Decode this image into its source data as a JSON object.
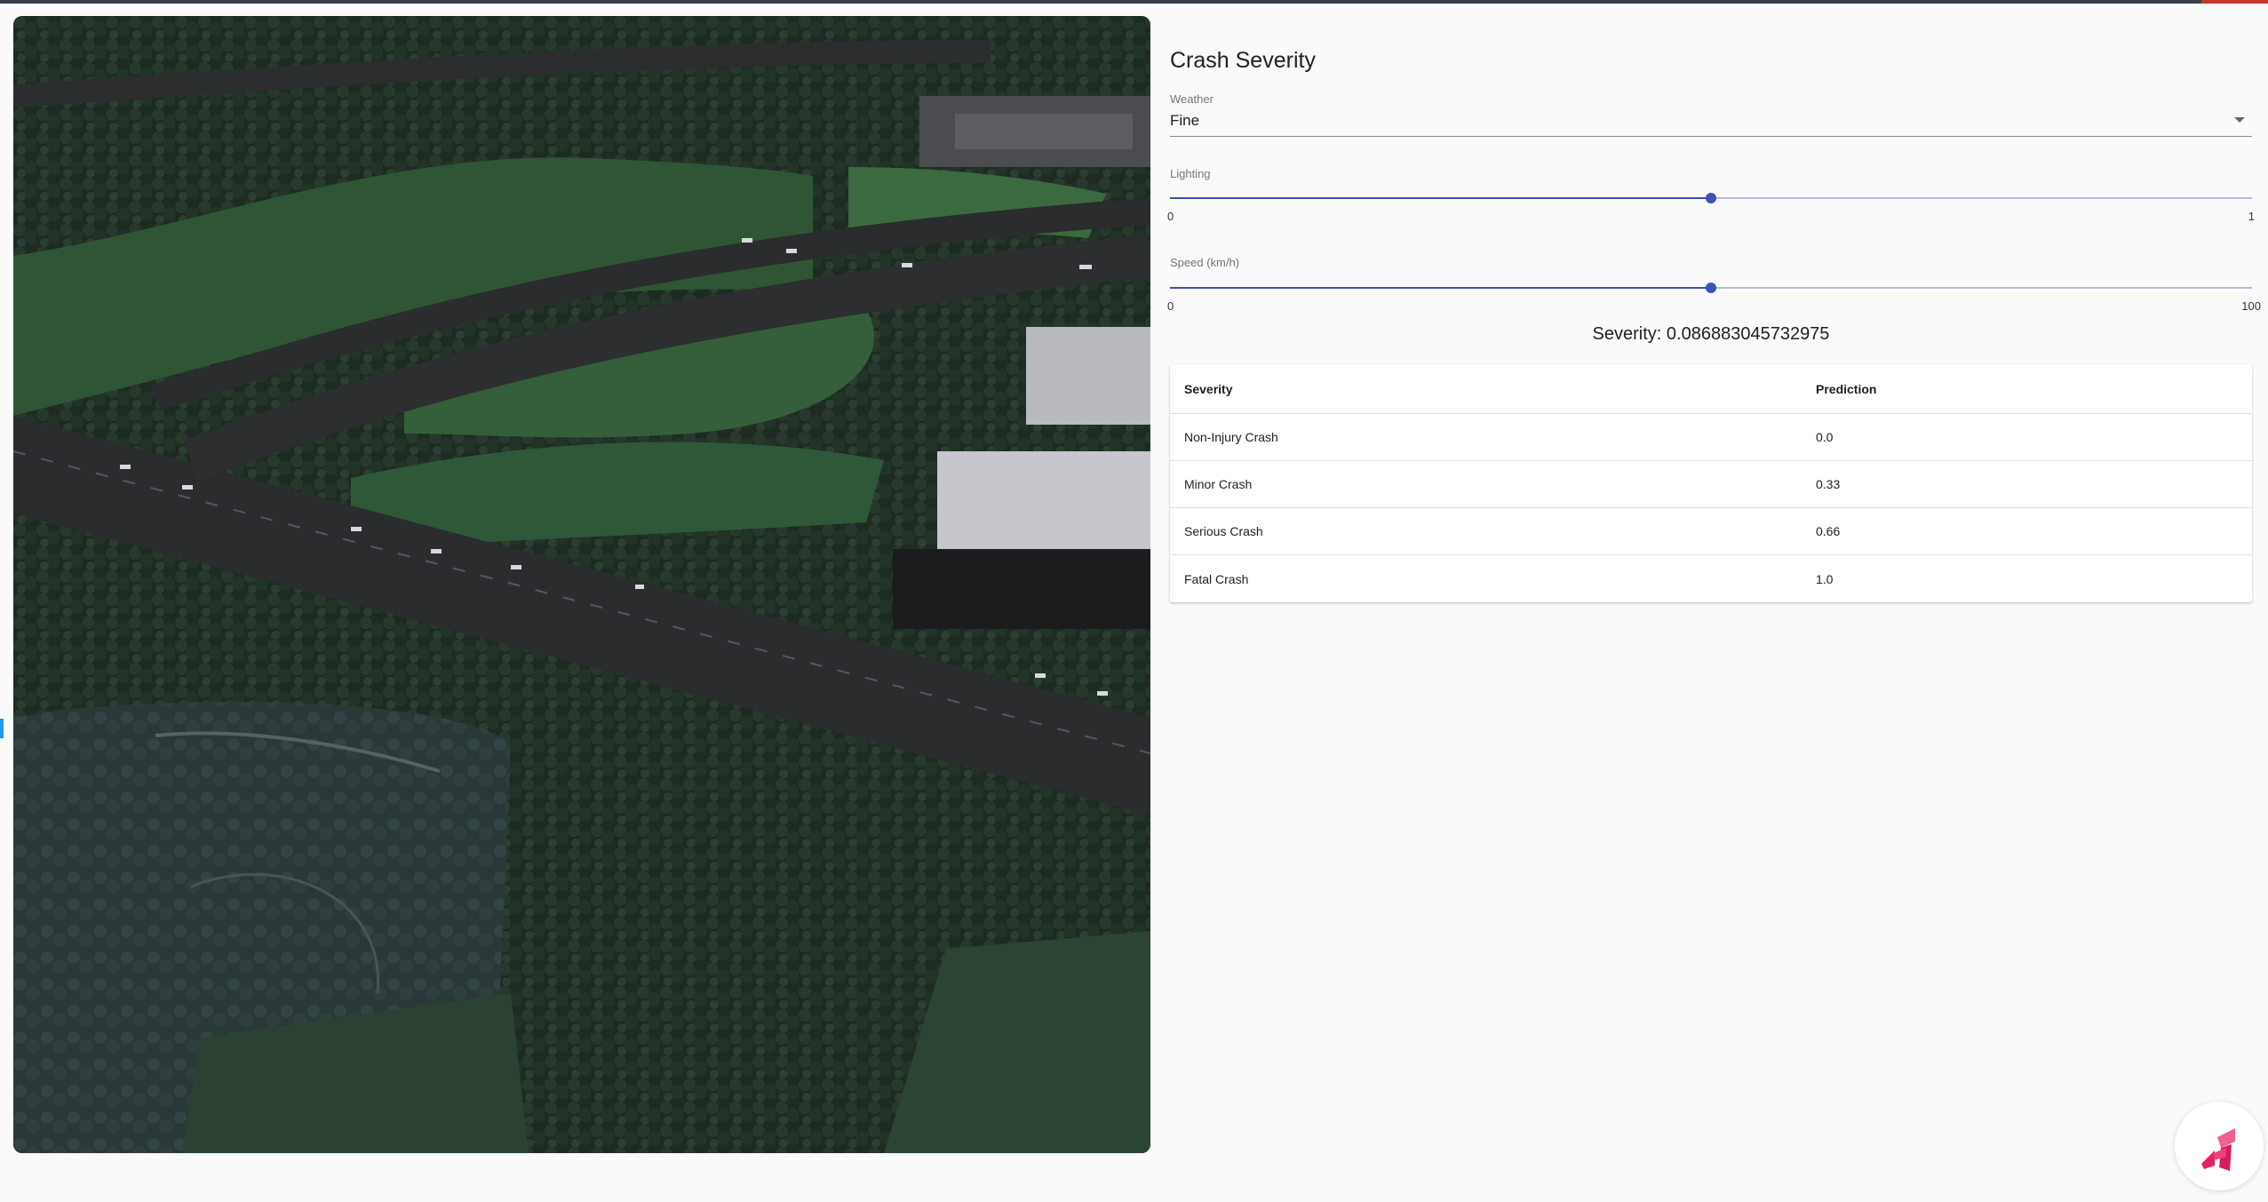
{
  "app": {
    "title": "Crash Severity",
    "accent_color": "#3f51b5"
  },
  "aerial_view": {
    "icon": "aerial-map-image"
  },
  "weather": {
    "label": "Weather",
    "value": "Fine",
    "icon": "chevron-down-icon"
  },
  "lighting": {
    "label": "Lighting",
    "min_label": "0",
    "max_label": "1",
    "value_fraction": 0.5
  },
  "speed": {
    "label": "Speed (km/h)",
    "min_label": "0",
    "max_label": "100",
    "value_fraction": 0.5
  },
  "result": {
    "severity_text": "Severity: 0.086883045732975"
  },
  "table": {
    "headers": [
      "Severity",
      "Prediction"
    ],
    "rows": [
      [
        "Non-Injury Crash",
        "0.0"
      ],
      [
        "Minor Crash",
        "0.33"
      ],
      [
        "Serious Crash",
        "0.66"
      ],
      [
        "Fatal Crash",
        "1.0"
      ]
    ]
  },
  "fab": {
    "icon": "app-logo-icon",
    "color": "#e91e63"
  }
}
